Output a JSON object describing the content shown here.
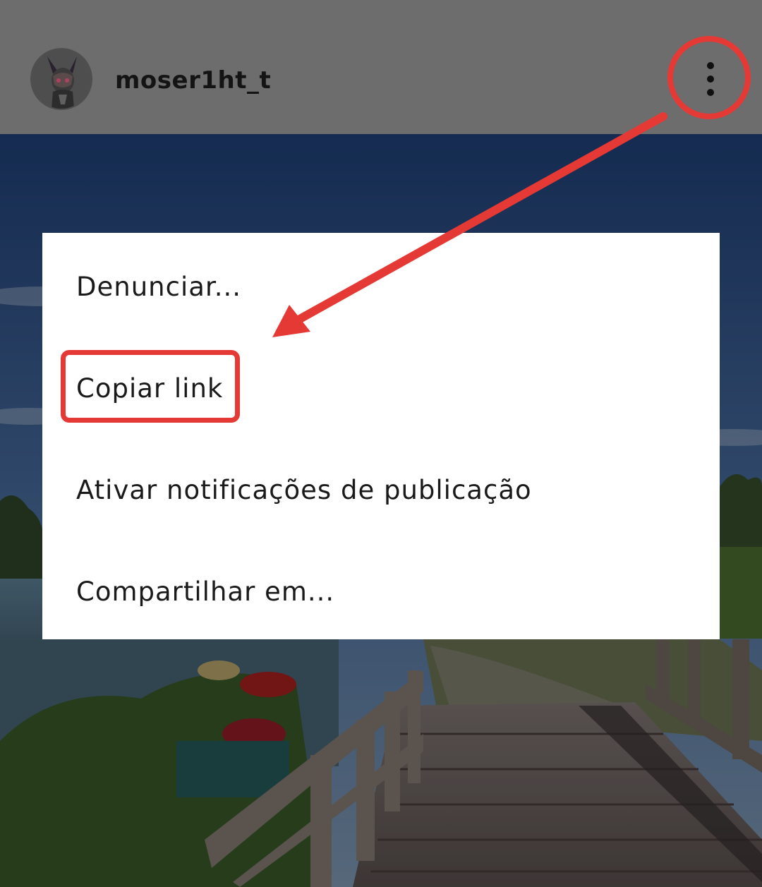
{
  "header": {
    "username": "moser1ht_t",
    "avatar_alt": "profile avatar",
    "more_icon": "more-vertical-icon"
  },
  "menu": {
    "items": [
      {
        "label": "Denunciar..."
      },
      {
        "label": "Copiar link"
      },
      {
        "label": "Ativar notificações de publicação"
      },
      {
        "label": "Compartilhar em..."
      }
    ]
  },
  "annotations": {
    "color": "#e53935",
    "highlighted_item": "Copiar link"
  },
  "colors": {
    "header_bg": "#6d6d6d",
    "menu_bg": "#ffffff",
    "annotation_red": "#e53935"
  }
}
